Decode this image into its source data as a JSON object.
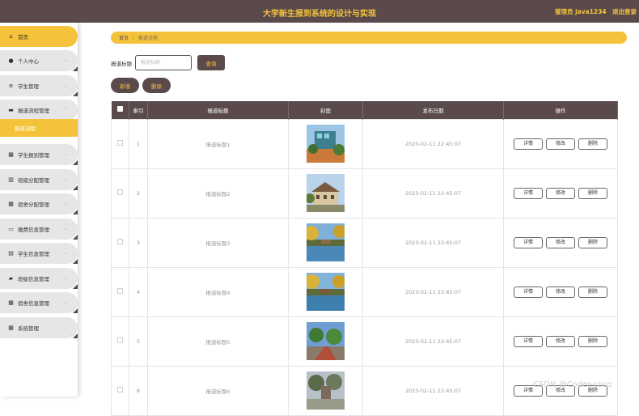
{
  "header": {
    "title": "大学新生报到系统的设计与实现",
    "user": "管理员 java1234",
    "logout": "退出登录"
  },
  "sidebar": {
    "items": [
      {
        "label": "首页",
        "icon": "home-icon"
      },
      {
        "label": "个人中心",
        "icon": "person-icon"
      },
      {
        "label": "学生管理",
        "icon": "list-icon"
      },
      {
        "label": "报道流程管理",
        "icon": "briefcase-icon"
      },
      {
        "label": "学生报到管理",
        "icon": "grid-icon"
      },
      {
        "label": "班级分配管理",
        "icon": "building-icon"
      },
      {
        "label": "宿舍分配管理",
        "icon": "grid-icon"
      },
      {
        "label": "缴费信息管理",
        "icon": "monitor-icon"
      },
      {
        "label": "学生信息管理",
        "icon": "clipboard-icon"
      },
      {
        "label": "班级信息管理",
        "icon": "id-card-icon"
      },
      {
        "label": "宿舍信息管理",
        "icon": "grid-icon"
      },
      {
        "label": "系统管理",
        "icon": "grid-icon"
      }
    ],
    "sub_item": "报道流程"
  },
  "breadcrumb": {
    "home": "首页",
    "separator": "/",
    "current": "报道流程"
  },
  "search": {
    "label": "报道标题",
    "placeholder": "报道标题",
    "query_button": "查询"
  },
  "actions": {
    "add": "新增",
    "delete": "删除"
  },
  "table": {
    "columns": [
      "索引",
      "报道标题",
      "封面",
      "发布日期",
      "操作"
    ],
    "rows": [
      {
        "index": "1",
        "title": "报道标题1",
        "date": "2023-02-11 22:45:07"
      },
      {
        "index": "2",
        "title": "报道标题2",
        "date": "2023-02-11 22:45:07"
      },
      {
        "index": "3",
        "title": "报道标题3",
        "date": "2023-02-11 22:45:07"
      },
      {
        "index": "4",
        "title": "报道标题4",
        "date": "2023-02-11 22:45:07"
      },
      {
        "index": "5",
        "title": "报道标题5",
        "date": "2023-02-11 22:45:07"
      },
      {
        "index": "6",
        "title": "报道标题6",
        "date": "2023-02-11 22:45:07"
      }
    ],
    "row_actions": {
      "detail": "详情",
      "edit": "修改",
      "delete": "删除"
    }
  },
  "watermark": "CSDN @Coder-coco",
  "colors": {
    "header_bg": "#5b4a4c",
    "accent": "#f5c33b",
    "sidebar_item_bg": "#e6e6e6"
  }
}
